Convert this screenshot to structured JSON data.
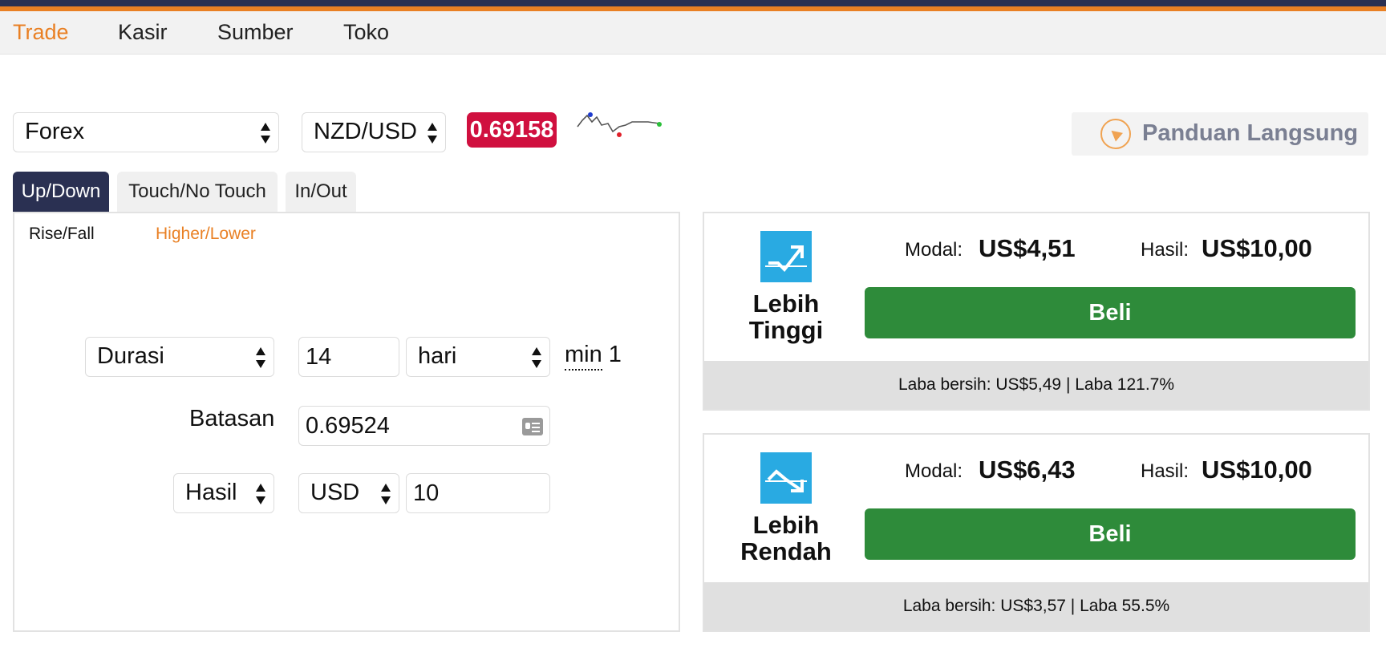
{
  "nav": {
    "items": [
      {
        "label": "Trade",
        "active": true
      },
      {
        "label": "Kasir",
        "active": false
      },
      {
        "label": "Sumber",
        "active": false
      },
      {
        "label": "Toko",
        "active": false
      }
    ]
  },
  "market": {
    "category": "Forex",
    "symbol": "NZD/USD",
    "price": "0.69158",
    "sparkline_icon": "price-trend-sparkline"
  },
  "guide": {
    "label": "Panduan Langsung",
    "icon": "navigation-arrow-icon"
  },
  "contract_tabs": [
    {
      "label": "Up/Down",
      "active": true
    },
    {
      "label": "Touch/No Touch",
      "active": false
    },
    {
      "label": "In/Out",
      "active": false
    }
  ],
  "sub_tabs": [
    {
      "label": "Rise/Fall",
      "active": false
    },
    {
      "label": "Higher/Lower",
      "active": true
    }
  ],
  "form": {
    "duration_type": "Durasi",
    "duration_value": "14",
    "duration_unit": "hari",
    "min_label": "min",
    "min_value": "1",
    "barrier_label": "Batasan",
    "barrier_value": "0.69524",
    "payout_type": "Hasil",
    "currency": "USD",
    "amount": "10"
  },
  "cards": [
    {
      "title_line1": "Lebih",
      "title_line2": "Tinggi",
      "icon": "trend-up-icon",
      "stake_label": "Modal:",
      "stake_value": "US$4,51",
      "payout_label": "Hasil:",
      "payout_value": "US$10,00",
      "button_label": "Beli",
      "footer": "Laba bersih: US$5,49 | Laba 121.7%"
    },
    {
      "title_line1": "Lebih",
      "title_line2": "Rendah",
      "icon": "trend-down-icon",
      "stake_label": "Modal:",
      "stake_value": "US$6,43",
      "payout_label": "Hasil:",
      "payout_value": "US$10,00",
      "button_label": "Beli",
      "footer": "Laba bersih: US$3,57 | Laba 55.5%"
    }
  ],
  "colors": {
    "accent_orange": "#e98024",
    "navy": "#2a3052",
    "price_red": "#d0103f",
    "buy_green": "#2e8b3a",
    "icon_blue": "#29aae2"
  }
}
